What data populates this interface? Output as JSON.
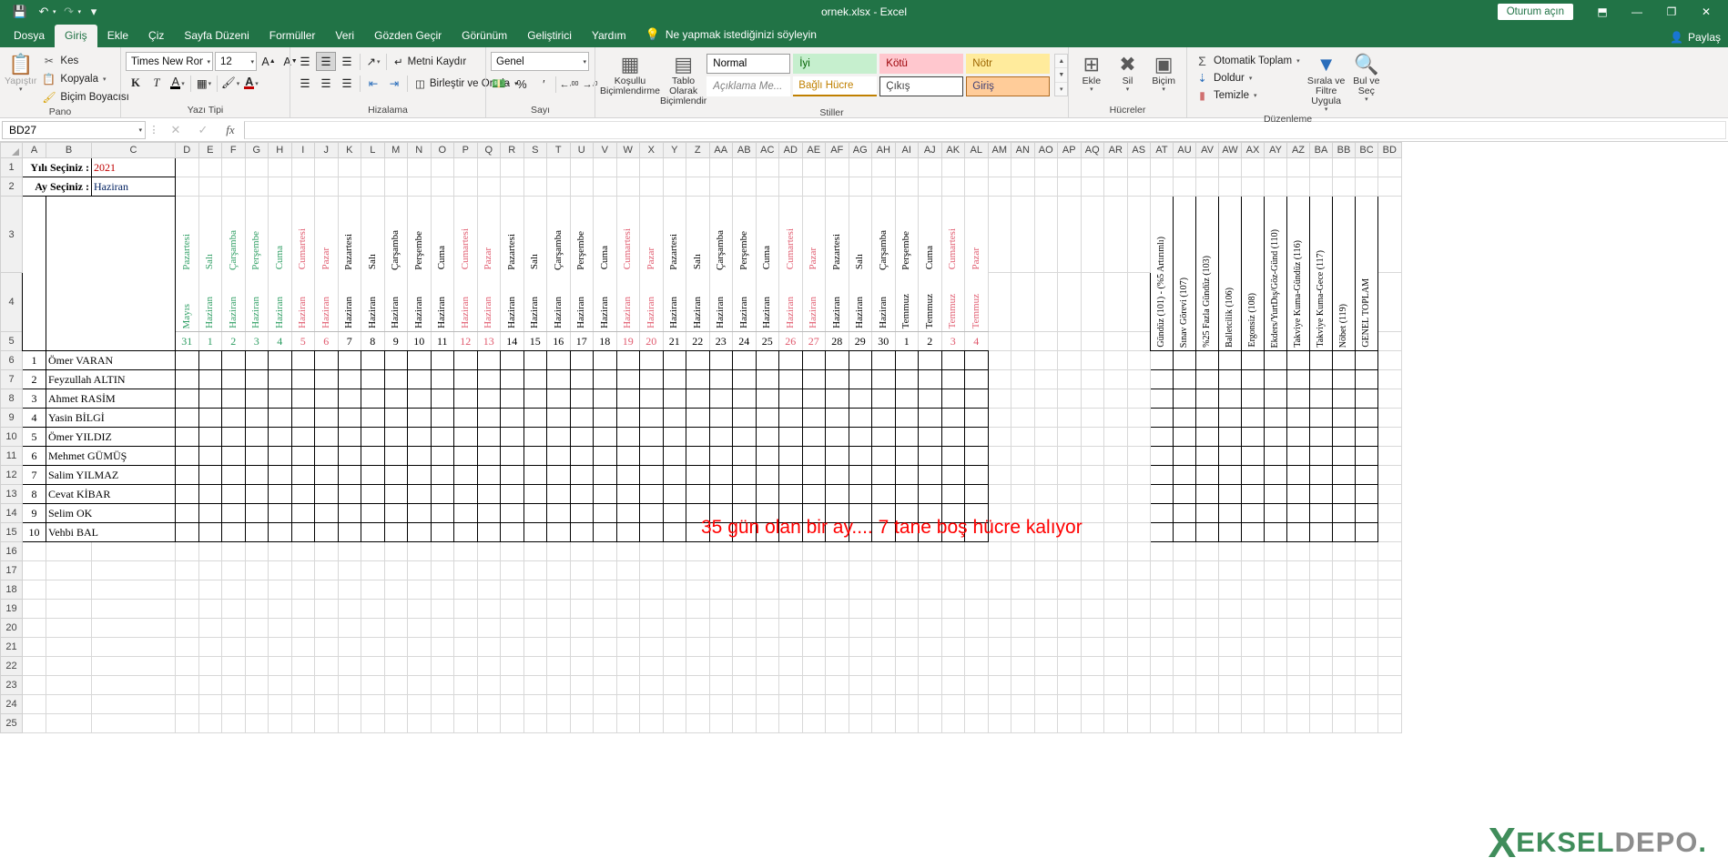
{
  "titlebar": {
    "document_title": "ornek.xlsx  -  Excel",
    "quick_access": [
      {
        "name": "save",
        "glyph": "⬚"
      },
      {
        "name": "undo",
        "glyph": "↶"
      },
      {
        "name": "redo",
        "glyph": "↷"
      },
      {
        "name": "customize",
        "glyph": "⌄"
      }
    ],
    "signin_label": "Oturum açın",
    "ribbon_display_glyph": "⬒",
    "minimize_glyph": "—",
    "restore_glyph": "❐",
    "close_glyph": "✕",
    "share_label": "Paylaş"
  },
  "tabs": [
    {
      "label": "Dosya",
      "active": false
    },
    {
      "label": "Giriş",
      "active": true
    },
    {
      "label": "Ekle",
      "active": false
    },
    {
      "label": "Çiz",
      "active": false
    },
    {
      "label": "Sayfa Düzeni",
      "active": false
    },
    {
      "label": "Formüller",
      "active": false
    },
    {
      "label": "Veri",
      "active": false
    },
    {
      "label": "Gözden Geçir",
      "active": false
    },
    {
      "label": "Görünüm",
      "active": false
    },
    {
      "label": "Geliştirici",
      "active": false
    },
    {
      "label": "Yardım",
      "active": false
    }
  ],
  "tellme": "Ne yapmak istediğinizi söyleyin",
  "ribbon": {
    "clipboard": {
      "group_label": "Pano",
      "paste_label": "Yapıştır",
      "cut_label": "Kes",
      "copy_label": "Kopyala",
      "format_painter_label": "Biçim Boyacısı"
    },
    "font": {
      "group_label": "Yazı Tipi",
      "font_name": "Times New Roma",
      "font_size": "12",
      "bold_label": "K",
      "italic_label": "T",
      "underline_label": "A",
      "grow_label": "A",
      "shrink_label": "A"
    },
    "alignment": {
      "group_label": "Hizalama",
      "wrap_text_label": "Metni Kaydır",
      "merge_center_label": "Birleştir ve Ortala"
    },
    "number": {
      "group_label": "Sayı",
      "format_value": "Genel",
      "percent_label": "%",
      "comma_label": " ′",
      "inc_dec_label": ",00",
      "dec_dec_label": ",0"
    },
    "styles": {
      "group_label": "Stiller",
      "conditional_label": "Koşullu Biçimlendirme",
      "table_label": "Tablo Olarak Biçimlendir",
      "cells": [
        {
          "label": "Normal",
          "bg": "#ffffff",
          "fg": "#000000",
          "border": "#9a9a9a"
        },
        {
          "label": "İyi",
          "bg": "#c6efce",
          "fg": "#006100",
          "border": "#c6efce"
        },
        {
          "label": "Kötü",
          "bg": "#ffc7ce",
          "fg": "#9c0006",
          "border": "#ffc7ce"
        },
        {
          "label": "Nötr",
          "bg": "#ffeb9c",
          "fg": "#9c6500",
          "border": "#ffeb9c"
        },
        {
          "label": "Açıklama Me...",
          "bg": "#ffffff",
          "fg": "#7f7f7f",
          "border": "#ffffff"
        },
        {
          "label": "Bağlı Hücre",
          "bg": "#ffffff",
          "fg": "#c08000",
          "border": "#c08000"
        },
        {
          "label": "Çıkış",
          "bg": "#ffffff",
          "fg": "#3f3f3f",
          "border": "#3f3f3f"
        },
        {
          "label": "Giriş",
          "bg": "#ffcc99",
          "fg": "#3f3f76",
          "border": "#b06a1f"
        }
      ]
    },
    "cells": {
      "group_label": "Hücreler",
      "insert_label": "Ekle",
      "delete_label": "Sil",
      "format_label": "Biçim"
    },
    "editing": {
      "group_label": "Düzenleme",
      "autosum_label": "Otomatik Toplam",
      "fill_label": "Doldur",
      "clear_label": "Temizle",
      "sort_filter_label": "Sırala ve Filtre Uygula",
      "find_select_label": "Bul ve Seç"
    }
  },
  "formula_bar": {
    "name_box_value": "BD27",
    "cancel_glyph": "✕",
    "enter_glyph": "✓",
    "function_glyph": "fx",
    "formula_value": ""
  },
  "sheet": {
    "column_headers": [
      "A",
      "B",
      "C",
      "D",
      "E",
      "F",
      "G",
      "H",
      "I",
      "J",
      "K",
      "L",
      "M",
      "N",
      "O",
      "P",
      "Q",
      "R",
      "S",
      "T",
      "U",
      "V",
      "W",
      "X",
      "Y",
      "Z",
      "AA",
      "AB",
      "AC",
      "AD",
      "AE",
      "AF",
      "AG",
      "AH",
      "AI",
      "AJ",
      "AK",
      "AL",
      "AM",
      "AN",
      "AO",
      "AP",
      "AQ",
      "AR",
      "AS",
      "AT",
      "AU",
      "AV",
      "AW",
      "AX",
      "AY",
      "AZ",
      "BA",
      "BB",
      "BC",
      "BD"
    ],
    "row_headers": [
      "1",
      "2",
      "3",
      "4",
      "5",
      "6",
      "7",
      "8",
      "9",
      "10",
      "11",
      "12",
      "13",
      "14",
      "15",
      "16",
      "17",
      "18",
      "19",
      "20",
      "21",
      "22",
      "23",
      "24",
      "25"
    ],
    "year_label": "Yılı Seçiniz :",
    "year_value": "2021",
    "month_label": "Ay Seçiniz :",
    "month_value": "Haziran",
    "calendar_columns": [
      {
        "col": "D",
        "day": "Pazartesi",
        "month": "Mayıs",
        "num": "31",
        "tone": "green"
      },
      {
        "col": "E",
        "day": "Salı",
        "month": "Haziran",
        "num": "1",
        "tone": "green"
      },
      {
        "col": "F",
        "day": "Çarşamba",
        "month": "Haziran",
        "num": "2",
        "tone": "green"
      },
      {
        "col": "G",
        "day": "Perşembe",
        "month": "Haziran",
        "num": "3",
        "tone": "green"
      },
      {
        "col": "H",
        "day": "Cuma",
        "month": "Haziran",
        "num": "4",
        "tone": "green"
      },
      {
        "col": "I",
        "day": "Cumartesi",
        "month": "Haziran",
        "num": "5",
        "tone": "red"
      },
      {
        "col": "J",
        "day": "Pazar",
        "month": "Haziran",
        "num": "6",
        "tone": "red"
      },
      {
        "col": "K",
        "day": "Pazartesi",
        "month": "Haziran",
        "num": "7",
        "tone": "black"
      },
      {
        "col": "L",
        "day": "Salı",
        "month": "Haziran",
        "num": "8",
        "tone": "black"
      },
      {
        "col": "M",
        "day": "Çarşamba",
        "month": "Haziran",
        "num": "9",
        "tone": "black"
      },
      {
        "col": "N",
        "day": "Perşembe",
        "month": "Haziran",
        "num": "10",
        "tone": "black"
      },
      {
        "col": "O",
        "day": "Cuma",
        "month": "Haziran",
        "num": "11",
        "tone": "black"
      },
      {
        "col": "P",
        "day": "Cumartesi",
        "month": "Haziran",
        "num": "12",
        "tone": "red"
      },
      {
        "col": "Q",
        "day": "Pazar",
        "month": "Haziran",
        "num": "13",
        "tone": "red"
      },
      {
        "col": "R",
        "day": "Pazartesi",
        "month": "Haziran",
        "num": "14",
        "tone": "black"
      },
      {
        "col": "S",
        "day": "Salı",
        "month": "Haziran",
        "num": "15",
        "tone": "black"
      },
      {
        "col": "T",
        "day": "Çarşamba",
        "month": "Haziran",
        "num": "16",
        "tone": "black"
      },
      {
        "col": "U",
        "day": "Perşembe",
        "month": "Haziran",
        "num": "17",
        "tone": "black"
      },
      {
        "col": "V",
        "day": "Cuma",
        "month": "Haziran",
        "num": "18",
        "tone": "black"
      },
      {
        "col": "W",
        "day": "Cumartesi",
        "month": "Haziran",
        "num": "19",
        "tone": "red"
      },
      {
        "col": "X",
        "day": "Pazar",
        "month": "Haziran",
        "num": "20",
        "tone": "red"
      },
      {
        "col": "Y",
        "day": "Pazartesi",
        "month": "Haziran",
        "num": "21",
        "tone": "black"
      },
      {
        "col": "Z",
        "day": "Salı",
        "month": "Haziran",
        "num": "22",
        "tone": "black"
      },
      {
        "col": "AA",
        "day": "Çarşamba",
        "month": "Haziran",
        "num": "23",
        "tone": "black"
      },
      {
        "col": "AB",
        "day": "Perşembe",
        "month": "Haziran",
        "num": "24",
        "tone": "black"
      },
      {
        "col": "AC",
        "day": "Cuma",
        "month": "Haziran",
        "num": "25",
        "tone": "black"
      },
      {
        "col": "AD",
        "day": "Cumartesi",
        "month": "Haziran",
        "num": "26",
        "tone": "red"
      },
      {
        "col": "AE",
        "day": "Pazar",
        "month": "Haziran",
        "num": "27",
        "tone": "red"
      },
      {
        "col": "AF",
        "day": "Pazartesi",
        "month": "Haziran",
        "num": "28",
        "tone": "black"
      },
      {
        "col": "AG",
        "day": "Salı",
        "month": "Haziran",
        "num": "29",
        "tone": "black"
      },
      {
        "col": "AH",
        "day": "Çarşamba",
        "month": "Haziran",
        "num": "30",
        "tone": "black"
      },
      {
        "col": "AI",
        "day": "Perşembe",
        "month": "Temmuz",
        "num": "1",
        "tone": "black"
      },
      {
        "col": "AJ",
        "day": "Cuma",
        "month": "Temmuz",
        "num": "2",
        "tone": "black"
      },
      {
        "col": "AK",
        "day": "Cumartesi",
        "month": "Temmuz",
        "num": "3",
        "tone": "red"
      },
      {
        "col": "AL",
        "day": "Pazar",
        "month": "Temmuz",
        "num": "4",
        "tone": "red"
      }
    ],
    "summary_columns": [
      {
        "col": "AT",
        "label": "Gündüz (101) - (%5 Artırımlı)"
      },
      {
        "col": "AU",
        "label": "Sınav Görevi (107)"
      },
      {
        "col": "AV",
        "label": "%25 Fazla Gündüz (103)"
      },
      {
        "col": "AW",
        "label": "Balletcilik (106)"
      },
      {
        "col": "AX",
        "label": "Ergonsiz (108)"
      },
      {
        "col": "AY",
        "label": "Ekders/YurtDış/Göz-Günd (110)"
      },
      {
        "col": "AZ",
        "label": "Takviye Kuma-Gündüz (116)"
      },
      {
        "col": "BA",
        "label": "Takviye Kuma-Gece (117)"
      },
      {
        "col": "BB",
        "label": "Nöbet (119)"
      },
      {
        "col": "BC",
        "label": "GENEL TOPLAM"
      }
    ],
    "employees": [
      {
        "no": "1",
        "name": "Ömer VARAN"
      },
      {
        "no": "2",
        "name": "Feyzullah ALTIN"
      },
      {
        "no": "3",
        "name": "Ahmet RASİM"
      },
      {
        "no": "4",
        "name": "Yasin BİLGİ"
      },
      {
        "no": "5",
        "name": "Ömer YILDIZ"
      },
      {
        "no": "6",
        "name": "Mehmet GÜMÜŞ"
      },
      {
        "no": "7",
        "name": "Salim YILMAZ"
      },
      {
        "no": "8",
        "name": "Cevat KİBAR"
      },
      {
        "no": "9",
        "name": "Selim OK"
      },
      {
        "no": "10",
        "name": "Vehbi BAL"
      }
    ],
    "annotation": "35 gün olan bir ay.... 7 tane boş hücre kalıyor",
    "annotation_color": "#ff0000",
    "watermark": {
      "x": "X",
      "part1": "EKSEL",
      "part2": "DEPO",
      "dot": "."
    }
  }
}
